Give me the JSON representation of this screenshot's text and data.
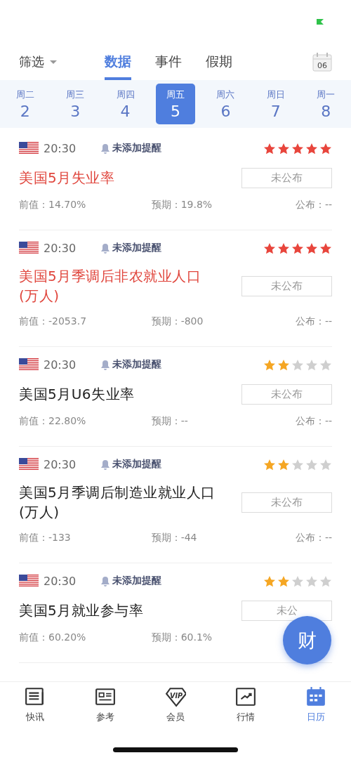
{
  "header": {
    "filter": "筛选",
    "tabs": [
      {
        "label": "数据",
        "selected": true
      },
      {
        "label": "事件",
        "selected": false
      },
      {
        "label": "假期",
        "selected": false
      }
    ],
    "calendar_day": "06"
  },
  "days": [
    {
      "weekday": "周二",
      "date": "2",
      "selected": false
    },
    {
      "weekday": "周三",
      "date": "3",
      "selected": false
    },
    {
      "weekday": "周四",
      "date": "4",
      "selected": false
    },
    {
      "weekday": "周五",
      "date": "5",
      "selected": true
    },
    {
      "weekday": "周六",
      "date": "6",
      "selected": false
    },
    {
      "weekday": "周日",
      "date": "7",
      "selected": false
    },
    {
      "weekday": "周一",
      "date": "8",
      "selected": false
    }
  ],
  "items": [
    {
      "time": "20:30",
      "reminder": "未添加提醒",
      "stars": 5,
      "highlighted": true,
      "title": "美国5月失业率",
      "status": "未公布",
      "previous": "前值：14.70%",
      "forecast": "预期：19.8%",
      "actual": "公布：--"
    },
    {
      "time": "20:30",
      "reminder": "未添加提醒",
      "stars": 5,
      "highlighted": true,
      "title": "美国5月季调后非农就业人口(万人)",
      "status": "未公布",
      "previous": "前值：-2053.7",
      "forecast": "预期：-800",
      "actual": "公布：--"
    },
    {
      "time": "20:30",
      "reminder": "未添加提醒",
      "stars": 2,
      "highlighted": false,
      "title": "美国5月U6失业率",
      "status": "未公布",
      "previous": "前值：22.80%",
      "forecast": "预期：--",
      "actual": "公布：--"
    },
    {
      "time": "20:30",
      "reminder": "未添加提醒",
      "stars": 2,
      "highlighted": false,
      "title": "美国5月季调后制造业就业人口(万人)",
      "status": "未公布",
      "previous": "前值：-133",
      "forecast": "预期：-44",
      "actual": "公布：--"
    },
    {
      "time": "20:30",
      "reminder": "未添加提醒",
      "stars": 2,
      "highlighted": false,
      "title": "美国5月就业参与率",
      "status": "未公",
      "previous": "前值：60.20%",
      "forecast": "预期：60.1%"
    }
  ],
  "fab": "财",
  "nav": [
    {
      "label": "快讯",
      "kind": "news",
      "selected": false
    },
    {
      "label": "参考",
      "kind": "card",
      "selected": false
    },
    {
      "label": "会员",
      "kind": "vip",
      "icon_text": "VIP",
      "selected": false
    },
    {
      "label": "行情",
      "kind": "chart",
      "selected": false
    },
    {
      "label": "日历",
      "kind": "calendar",
      "selected": true
    }
  ]
}
